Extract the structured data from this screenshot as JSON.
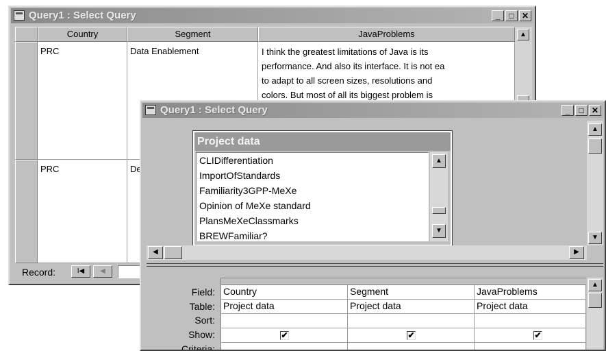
{
  "back_window": {
    "title": "Query1 : Select Query",
    "columns": [
      "Country",
      "Segment",
      "JavaProblems"
    ],
    "rows": [
      {
        "country": "PRC",
        "segment": "Data Enablement",
        "java_lines": [
          "I think the greatest limitations of Java is its",
          "performance.  And also its interface. It is not ea",
          "to adapt to all screen sizes, resolutions and",
          "colors.  But most of all its biggest problem is"
        ]
      },
      {
        "country": "PRC",
        "segment": "De"
      }
    ],
    "record_label": "Record:",
    "nav_first": "I◀",
    "nav_prev": "◀"
  },
  "front_window": {
    "title": "Query1 : Select Query",
    "table_box": {
      "title": "Project data",
      "fields": [
        "CLIDifferentiation",
        "ImportOfStandards",
        "Familiarity3GPP-MeXe",
        "Opinion of MeXe standard",
        "PlansMeXeClassmarks",
        "BREWFamiliar?"
      ]
    },
    "grid": {
      "row_labels": [
        "Field:",
        "Table:",
        "Sort:",
        "Show:",
        "Criteria:"
      ],
      "columns": [
        {
          "field": "Country",
          "table": "Project data",
          "show": "✔"
        },
        {
          "field": "Segment",
          "table": "Project data",
          "show": "✔"
        },
        {
          "field": "JavaProblems",
          "table": "Project data",
          "show": "✔"
        }
      ]
    }
  },
  "window_buttons": {
    "minimize": "_",
    "maximize": "□",
    "close": "✕"
  },
  "scroll_arrows": {
    "up": "▲",
    "down": "▼",
    "left": "◀",
    "right": "▶"
  }
}
